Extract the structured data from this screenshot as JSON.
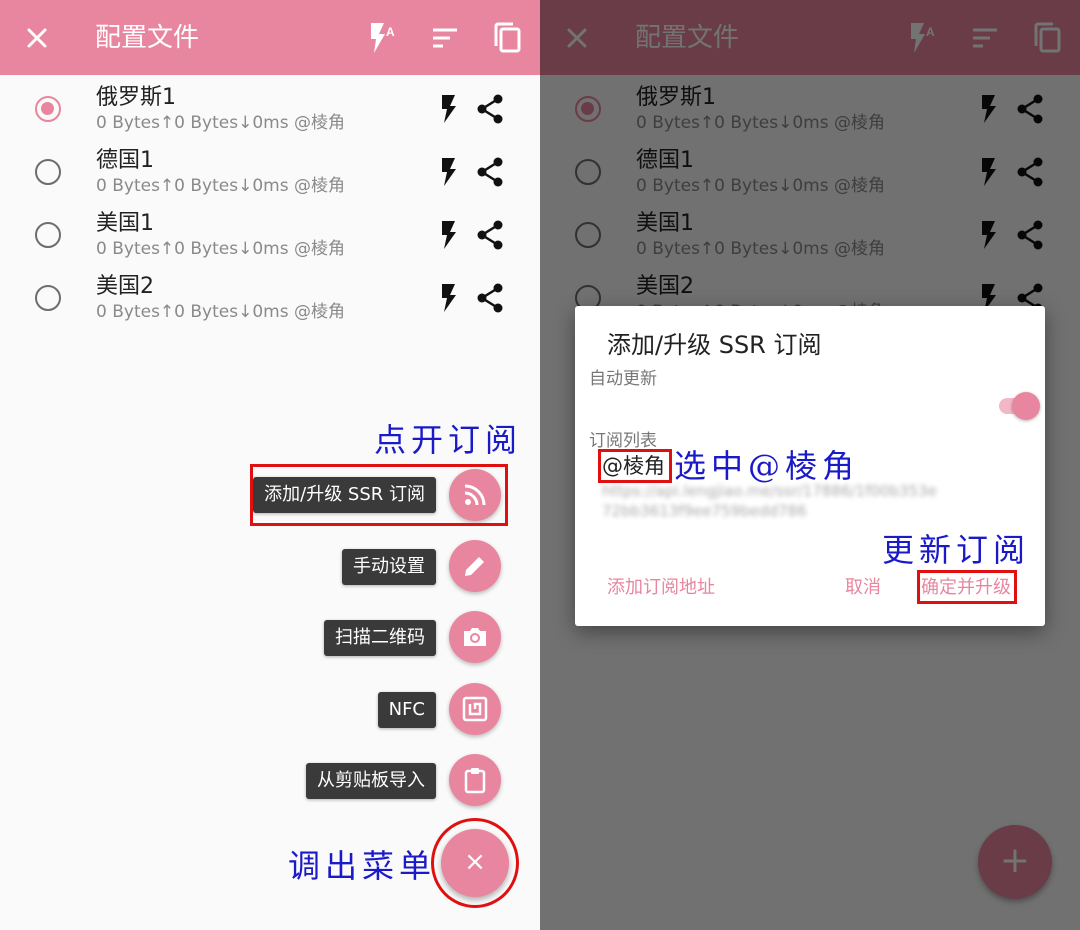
{
  "toolbar": {
    "title": "配置文件",
    "actions": [
      "flash-auto-icon",
      "sort-icon",
      "copy-icon"
    ]
  },
  "profiles": [
    {
      "name": "俄罗斯1",
      "stats": "0 Bytes↑0 Bytes↓0ms @棱角",
      "selected": true
    },
    {
      "name": "德国1",
      "stats": "0 Bytes↑0 Bytes↓0ms @棱角",
      "selected": false
    },
    {
      "name": "美国1",
      "stats": "0 Bytes↑0 Bytes↓0ms @棱角",
      "selected": false
    },
    {
      "name": "美国2",
      "stats": "0 Bytes↑0 Bytes↓0ms @棱角",
      "selected": false
    }
  ],
  "fab_menu": {
    "subscribe": "添加/升级 SSR 订阅",
    "manual": "手动设置",
    "scan_qr": "扫描二维码",
    "nfc": "NFC",
    "clipboard": "从剪贴板导入",
    "close_symbol": "×"
  },
  "annotations": {
    "open_subscription": "点开订阅",
    "open_menu": "调出菜单",
    "select_tag": "选中@棱角",
    "update_subscription": "更新订阅"
  },
  "dialog": {
    "title": "添加/升级 SSR 订阅",
    "auto_update_label": "自动更新",
    "auto_update_on": true,
    "list_label": "订阅列表",
    "selected_tag": "@棱角",
    "url_blurred": "https://api.lengjiao.me/ssr/17886/1f00b353e72bb3613f9ee759bedd786",
    "add_url_button": "添加订阅地址",
    "cancel_button": "取消",
    "confirm_button": "确定并升级"
  },
  "add_fab_symbol": "+",
  "colors": {
    "accent": "#e8869f",
    "annotation": "#1a1ac8",
    "highlight_box": "#e01010"
  }
}
